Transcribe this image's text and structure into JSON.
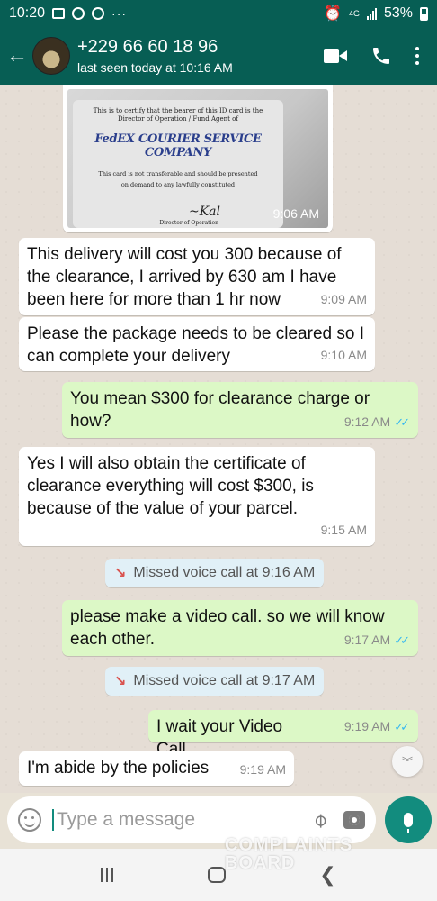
{
  "status_bar": {
    "time": "10:20",
    "network": "4G",
    "battery": "53%"
  },
  "header": {
    "contact_name": "+229 66 60 18 96",
    "last_seen": "last seen today at 10:16 AM"
  },
  "image_message": {
    "card_line1": "This is to certify that the bearer of this ID card is the",
    "card_line2": "Director of Operation / Fund Agent of",
    "card_brand": "FedEX COURIER SERVICE COMPANY",
    "card_line3": "This card is not transferable and should be presented",
    "card_line4": "on demand to any lawfully constituted",
    "card_role": "Director of Operation",
    "time": "9:06 AM"
  },
  "messages": [
    {
      "text": "This delivery will cost you 300 because of the clearance, I arrived by 630 am I have been here for more than 1 hr now",
      "time": "9:09 AM"
    },
    {
      "text": "Please the package needs to be cleared so I can complete your delivery",
      "time": "9:10 AM"
    },
    {
      "text": "You mean $300 for clearance charge or how?",
      "time": "9:12 AM"
    },
    {
      "text": "Yes I will also obtain the certificate of clearance everything will cost $300, is because of the value of your parcel.",
      "time": "9:15 AM"
    },
    {
      "text": "Missed voice call at 9:16 AM"
    },
    {
      "text": "please make a video call. so we will know each other.",
      "time": "9:17 AM"
    },
    {
      "text": "Missed voice call at 9:17 AM"
    },
    {
      "text": "I wait your Video Call.",
      "time": "9:19 AM"
    },
    {
      "text": "I'm abide by the policies",
      "time": "9:19 AM"
    }
  ],
  "input": {
    "placeholder": "Type a message"
  },
  "watermark": {
    "line1": "COMPLAINTS",
    "line2": "BOARD"
  },
  "colors": {
    "header": "#075e54",
    "outgoing": "#dcf8c6",
    "incoming": "#ffffff",
    "accent": "#128c7e",
    "read_ticks": "#34b7f1"
  }
}
